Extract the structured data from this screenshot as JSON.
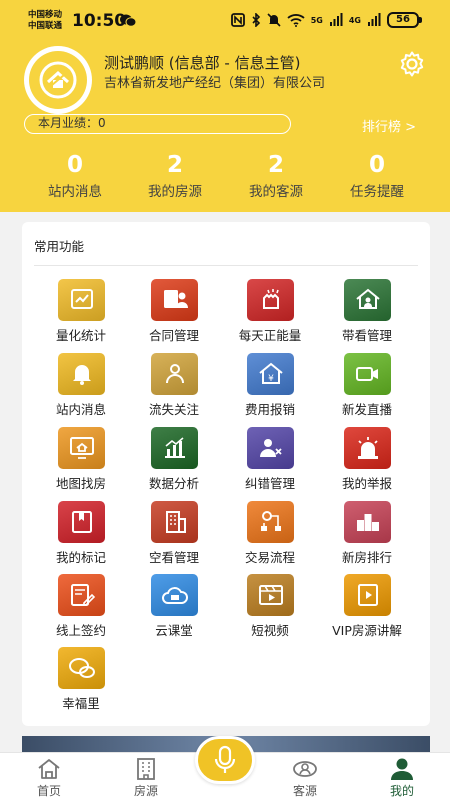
{
  "status_bar": {
    "carrier_1": "中国移动",
    "carrier_2": "中国联通",
    "time": "10:50",
    "net_1": "5G",
    "net_2": "4G",
    "battery": "56"
  },
  "profile": {
    "name": "测试鹏顺 (信息部 - 信息主管)",
    "company": "吉林省新发地产经纪（集团）有限公司",
    "performance_label": "本月业绩：",
    "performance_value": "0",
    "ranking_link": "排行榜 >"
  },
  "stats": [
    {
      "value": "0",
      "label": "站内消息"
    },
    {
      "value": "2",
      "label": "我的房源"
    },
    {
      "value": "2",
      "label": "我的客源"
    },
    {
      "value": "0",
      "label": "任务提醒"
    }
  ],
  "functions": {
    "title": "常用功能",
    "items": [
      {
        "label": "量化统计",
        "icon": "chart-doc-icon",
        "color": "#f3c64a"
      },
      {
        "label": "合同管理",
        "icon": "contract-icon",
        "color": "#e2593b"
      },
      {
        "label": "每天正能量",
        "icon": "fist-icon",
        "color": "#d94848"
      },
      {
        "label": "带看管理",
        "icon": "house-person-icon",
        "color": "#4c8a55"
      },
      {
        "label": "站内消息",
        "icon": "bell-icon",
        "color": "#f2c443"
      },
      {
        "label": "流失关注",
        "icon": "person-icon",
        "color": "#d8b259"
      },
      {
        "label": "费用报销",
        "icon": "yen-house-icon",
        "color": "#5f8fd6"
      },
      {
        "label": "新发直播",
        "icon": "video-camera-icon",
        "color": "#7cc245"
      },
      {
        "label": "地图找房",
        "icon": "map-house-icon",
        "color": "#f0a742"
      },
      {
        "label": "数据分析",
        "icon": "bar-chart-icon",
        "color": "#3f7f47"
      },
      {
        "label": "纠错管理",
        "icon": "person-x-icon",
        "color": "#6e62b5"
      },
      {
        "label": "我的举报",
        "icon": "siren-icon",
        "color": "#e0483d"
      },
      {
        "label": "我的标记",
        "icon": "bookmark-icon",
        "color": "#d9434a"
      },
      {
        "label": "空看管理",
        "icon": "building-icon",
        "color": "#cf5a44"
      },
      {
        "label": "交易流程",
        "icon": "flow-icon",
        "color": "#f08a3c"
      },
      {
        "label": "新房排行",
        "icon": "podium-icon",
        "color": "#cf5f70"
      },
      {
        "label": "线上签约",
        "icon": "sign-doc-icon",
        "color": "#ef6a3d"
      },
      {
        "label": "云课堂",
        "icon": "cloud-icon",
        "color": "#4f9de8"
      },
      {
        "label": "短视频",
        "icon": "film-icon",
        "color": "#c69242"
      },
      {
        "label": "VIP房源讲解",
        "icon": "play-doc-icon",
        "color": "#f0a928"
      },
      {
        "label": "幸福里",
        "icon": "chat-bubbles-icon",
        "color": "#f2b830"
      }
    ]
  },
  "tabbar": [
    {
      "label": "首页",
      "icon": "home-icon"
    },
    {
      "label": "房源",
      "icon": "building-icon"
    },
    {
      "label": "客源",
      "icon": "client-icon"
    },
    {
      "label": "我的",
      "icon": "profile-icon",
      "active": true
    }
  ],
  "colors": {
    "header": "#f7d43f",
    "active_tab": "#1f5c36",
    "voice_button": "#f0c326"
  }
}
